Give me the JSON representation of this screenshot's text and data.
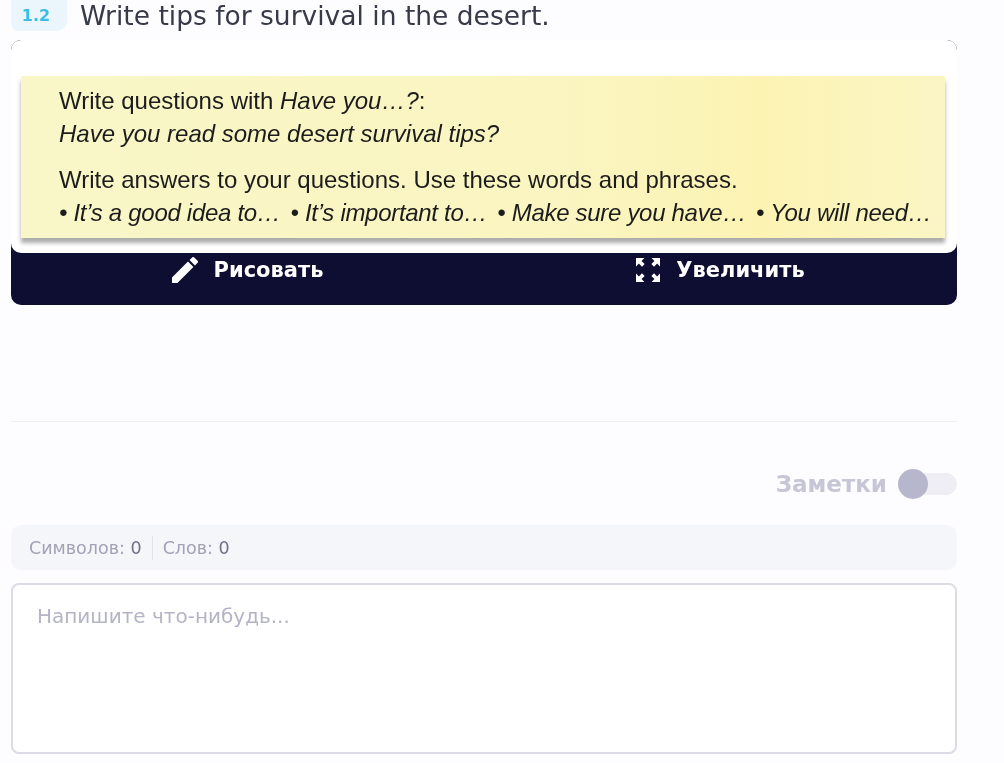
{
  "exercise": {
    "number": "1.2",
    "title": "Write tips for survival in the desert."
  },
  "textbook_excerpt": {
    "lines": [
      {
        "kind": "instruction",
        "text": "Write questions with *Have you…?*:"
      },
      {
        "kind": "example",
        "text": "Have you read some desert survival tips?"
      },
      {
        "kind": "instruction",
        "text": "Write answers to your questions. Use these words and phrases."
      },
      {
        "kind": "phrases",
        "items": [
          "• It’s a good idea to…",
          "• It’s important to…",
          "• Make sure you have…",
          "• You will need…"
        ]
      }
    ]
  },
  "image_toolbar": {
    "buttons": [
      {
        "kind": "draw",
        "label": "Рисовать"
      },
      {
        "kind": "zoom",
        "label": "Увеличить"
      }
    ]
  },
  "notes": {
    "label": "Заметки",
    "on": false
  },
  "counters": [
    {
      "label": "Символов:",
      "value": "0"
    },
    {
      "label": "Слов:",
      "value": "0"
    }
  ],
  "answer": {
    "placeholder": "Напишите что-нибудь..."
  }
}
